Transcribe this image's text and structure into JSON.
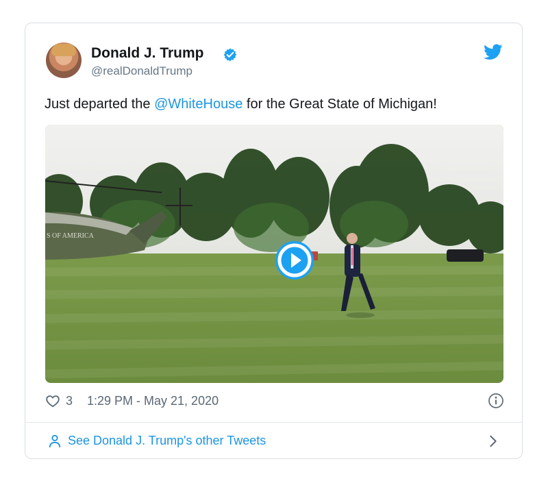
{
  "tweet": {
    "author_name": "Donald J. Trump",
    "handle": "@realDonaldTrump",
    "text_before": "Just departed the ",
    "mention": "@WhiteHouse",
    "text_after": " for the Great State of Michigan!",
    "likes": "3",
    "timestamp": "1:29 PM - May 21, 2020",
    "see_other": "See Donald J. Trump's other Tweets",
    "helicopter_text": "S OF AMERICA"
  },
  "colors": {
    "twitter_blue": "#1da1f2",
    "link_blue": "#1b95e0",
    "text_dark": "#14171a",
    "text_gray": "#657786"
  },
  "icons": [
    "verified-icon",
    "twitter-bird-icon",
    "play-icon",
    "heart-icon",
    "info-icon",
    "user-icon",
    "chevron-right-icon"
  ]
}
